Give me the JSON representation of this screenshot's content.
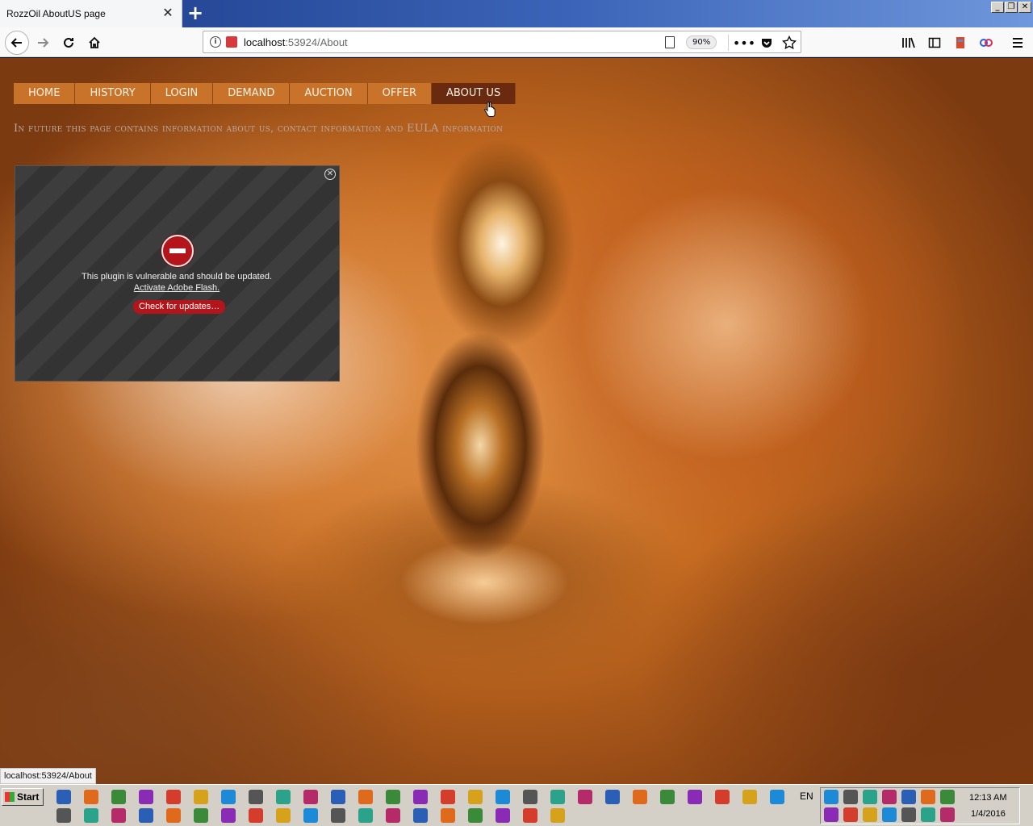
{
  "window": {
    "tab_title": "RozzOil AboutUS page",
    "tab_close": "✕",
    "new_tab": "+",
    "minimize": "_",
    "restore": "❐",
    "close": "✕"
  },
  "toolbar": {
    "url_host": "localhost",
    "url_path": ":53924/About",
    "zoom": "90%",
    "page_actions": "•••"
  },
  "page": {
    "nav": [
      "HOME",
      "HISTORY",
      "LOGIN",
      "DEMAND",
      "AUCTION",
      "OFFER",
      "ABOUT US"
    ],
    "active_nav": "ABOUT US",
    "headline": "In future this page contains information about us, contact information and EULA information"
  },
  "plugin": {
    "message": "This plugin is vulnerable and should be updated.",
    "link": "Activate Adobe Flash.",
    "button": "Check for updates…",
    "close": "✕"
  },
  "status_bar": {
    "text": "localhost:53924/About"
  },
  "taskbar": {
    "start": "Start",
    "language": "EN",
    "time": "12:13 AM",
    "date": "1/4/2016",
    "icon_colors": [
      "#2b5fb5",
      "#e06a1c",
      "#3a8a3a",
      "#8a2bb5",
      "#d43c2c",
      "#d6a21c",
      "#1c8ad6",
      "#555555",
      "#2ba38a",
      "#b52b6a"
    ]
  },
  "colors": {
    "nav_bg": "#c8722a",
    "nav_active_bg": "#6a2a10",
    "plugin_button": "#b3151a",
    "tab_strip": "#2b4f9e"
  }
}
